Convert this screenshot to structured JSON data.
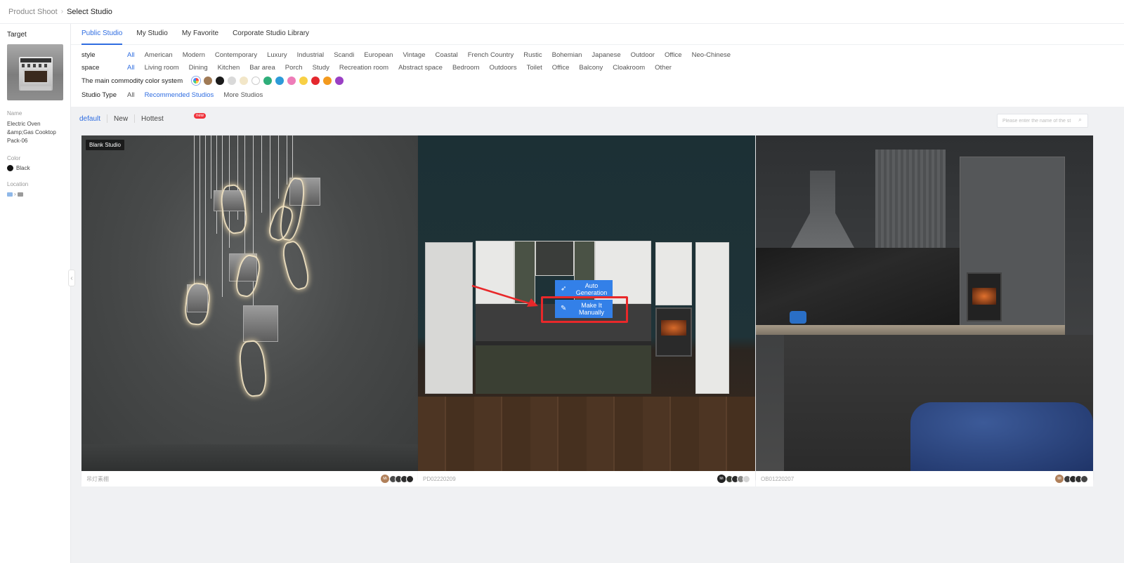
{
  "breadcrumb": {
    "root": "Product Shoot",
    "current": "Select Studio"
  },
  "left_panel": {
    "target_title": "Target",
    "name_label": "Name",
    "name_value": "Electric Oven &amp;Gas Cooktop Pack-06",
    "color_label": "Color",
    "color_value": "Black",
    "color_hex": "#111111",
    "location_label": "Location"
  },
  "tabs": [
    "Public Studio",
    "My Studio",
    "My Favorite",
    "Corporate Studio Library"
  ],
  "active_tab": "Public Studio",
  "filters": {
    "style": {
      "label": "style",
      "options": [
        "All",
        "American",
        "Modern",
        "Contemporary",
        "Luxury",
        "Industrial",
        "Scandi",
        "European",
        "Vintage",
        "Coastal",
        "French Country",
        "Rustic",
        "Bohemian",
        "Japanese",
        "Outdoor",
        "Office",
        "Neo-Chinese"
      ]
    },
    "space": {
      "label": "space",
      "options": [
        "All",
        "Living room",
        "Dining",
        "Kitchen",
        "Bar area",
        "Porch",
        "Study",
        "Recreation room",
        "Abstract space",
        "Bedroom",
        "Outdoors",
        "Toilet",
        "Office",
        "Balcony",
        "Cloakroom",
        "Other"
      ]
    },
    "color_system": {
      "label": "The main commodity color system",
      "swatches": [
        "all",
        "#a07a55",
        "#1a1a1a",
        "#d9d9d9",
        "#f2e6c8",
        "#ffffff",
        "#2fae7a",
        "#2d9ad8",
        "#ee7cb8",
        "#f8d045",
        "#e4282e",
        "#f39a1e",
        "#9a3fc4"
      ]
    },
    "studio_type": {
      "label": "Studio Type",
      "options": [
        "All",
        "Recommended Studios",
        "More Studios"
      ],
      "active": "Recommended Studios"
    }
  },
  "sort": {
    "options": [
      "default",
      "New",
      "Hottest"
    ],
    "active": "default",
    "new_badge": "new"
  },
  "search": {
    "placeholder": "Please enter the name of the st"
  },
  "cards": [
    {
      "badge": "Blank Studio",
      "code": "吊灯素棚",
      "avatar": "Mi",
      "swatches": [
        "#4a4a4a",
        "#3b3b3b",
        "#2f2f2f",
        "#262626"
      ]
    },
    {
      "code": "PD02220209",
      "avatar": "Mi",
      "swatches": [
        "#3a3d35",
        "#2a2a2a",
        "#8a8a88",
        "#d5d5d5"
      ]
    },
    {
      "code": "OB01220207",
      "avatar": "Mi",
      "swatches": [
        "#3b3b3b",
        "#2b2b2b",
        "#333333",
        "#444444"
      ]
    }
  ],
  "overlay": {
    "auto_generation": "Auto Generation",
    "make_it_manually": "Make It Manually"
  },
  "colors": {
    "accent": "#2f6de1",
    "overlay_button": "#3380e8",
    "highlight": "#e8282a"
  }
}
